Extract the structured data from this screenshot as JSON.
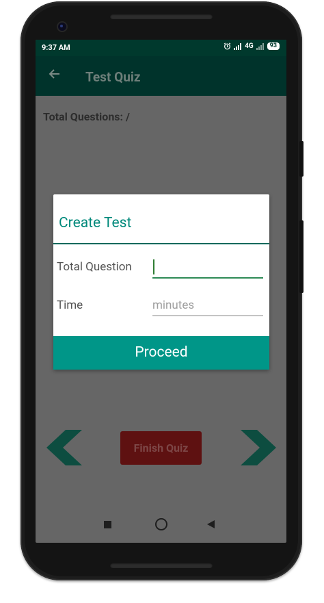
{
  "status_bar": {
    "time": "9:37 AM",
    "network": "4G",
    "battery": "93"
  },
  "app_bar": {
    "back_icon": "arrow-back-icon",
    "title": "Test Quiz"
  },
  "main": {
    "total_questions": "Total Questions: /",
    "finish_quiz": "Finish Quiz",
    "prev_icon": "chevron-left-icon",
    "next_icon": "chevron-right-icon"
  },
  "dialog": {
    "title": "Create Test",
    "total_question_label": "Total Question",
    "total_question_value": "",
    "time_label": "Time",
    "time_placeholder": "minutes",
    "proceed_label": "Proceed"
  },
  "colors": {
    "status_bar": "#00392d",
    "app_bar": "#00332b",
    "accent": "#009688",
    "dialog_title": "#00897b",
    "finish_button": "#5e1111",
    "nav_arrow": "#0d4d40",
    "scrim": "#666666"
  }
}
